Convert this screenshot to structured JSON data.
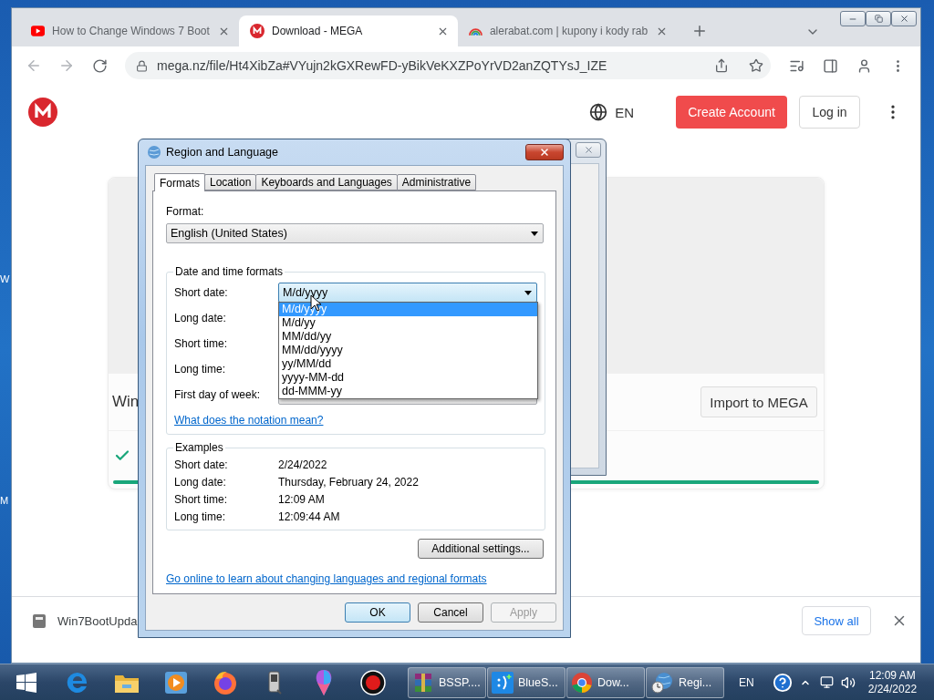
{
  "desktop": {
    "icon_labels": [
      "W",
      "M"
    ]
  },
  "browser": {
    "tabs": [
      {
        "title": "How to Change Windows 7 Boot",
        "kind": "video",
        "selected": false
      },
      {
        "title": "Download - MEGA",
        "kind": "mega",
        "selected": true
      },
      {
        "title": "alerabat.com | kupony i kody rab",
        "kind": "rainbow",
        "selected": false
      }
    ],
    "url": "mega.nz/file/Ht4XibZa#VYujn2kGXRewFD-yBikVeKXZPoYrVD2anZQTYsJ_IZE"
  },
  "page": {
    "language": "EN",
    "create_account": "Create Account",
    "login": "Log in",
    "file_name": "Win",
    "import_button": "Import to MEGA",
    "progress": {
      "level": 1
    }
  },
  "download_bar": {
    "file": "Win7BootUpda",
    "show_all": "Show all"
  },
  "dialog": {
    "title": "Region and Language",
    "tabs": [
      {
        "label": "Formats",
        "selected": true
      },
      {
        "label": "Location",
        "selected": false
      },
      {
        "label": "Keyboards and Languages",
        "selected": false
      },
      {
        "label": "Administrative",
        "selected": false
      }
    ],
    "format_label": "Format:",
    "format_value": "English (United States)",
    "group_title": "Date and time formats",
    "rows": [
      {
        "label": "Short date:",
        "kind": "open",
        "value": "M/d/yyyy"
      },
      {
        "label": "Long date:",
        "kind": "covered"
      },
      {
        "label": "Short time:",
        "kind": "covered"
      },
      {
        "label": "Long time:",
        "kind": "covered"
      },
      {
        "label": "First day of week:",
        "kind": "partly"
      }
    ],
    "options": [
      {
        "label": "M/d/yyyy",
        "selected": true
      },
      {
        "label": "M/d/yy",
        "selected": false
      },
      {
        "label": "MM/dd/yy",
        "selected": false
      },
      {
        "label": "MM/dd/yyyy",
        "selected": false
      },
      {
        "label": "yy/MM/dd",
        "selected": false
      },
      {
        "label": "yyyy-MM-dd",
        "selected": false
      },
      {
        "label": "dd-MMM-yy",
        "selected": false
      }
    ],
    "notation_link": "What does the notation mean?",
    "examples": {
      "title": "Examples",
      "rows": [
        {
          "label": "Short date:",
          "value": "2/24/2022"
        },
        {
          "label": "Long date:",
          "value": "Thursday, February 24, 2022"
        },
        {
          "label": "Short time:",
          "value": "12:09 AM"
        },
        {
          "label": "Long time:",
          "value": "12:09:44 AM"
        }
      ]
    },
    "additional_button": "Additional settings...",
    "online_link": "Go online to learn about changing languages and regional formats",
    "buttons": [
      {
        "label": "OK",
        "kind": "default",
        "disabled": false
      },
      {
        "label": "Cancel",
        "kind": "normal",
        "disabled": false
      },
      {
        "label": "Apply",
        "kind": "normal",
        "disabled": true
      }
    ]
  },
  "taskbar": {
    "tasks": [
      {
        "label": "BSSP....",
        "kind": "archive"
      },
      {
        "label": "BlueS...",
        "kind": "smiley"
      },
      {
        "label": "Dow...",
        "kind": "chrome"
      },
      {
        "label": "Regi...",
        "kind": "globe-clock"
      }
    ],
    "language": "EN",
    "time": "12:09 AM",
    "date": "2/24/2022"
  }
}
